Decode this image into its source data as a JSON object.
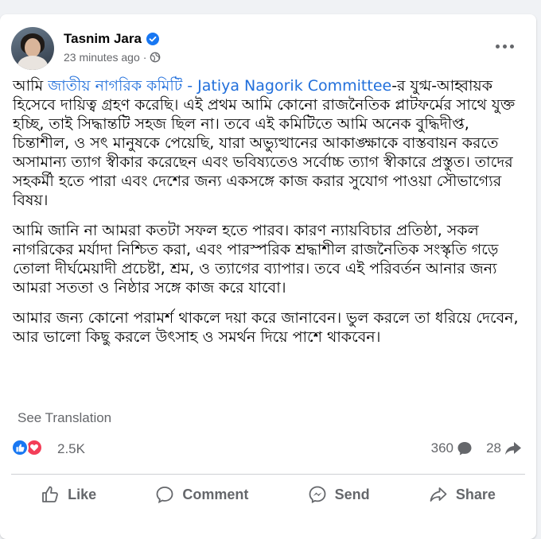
{
  "post": {
    "author": "Tasnim Jara",
    "timestamp": "23 minutes ago",
    "separator": "·",
    "paragraphs": {
      "p1_prefix": "আমি ",
      "p1_link1": "জাতীয় নাগরিক কমিটি - Jatiya Nagorik Committee",
      "p1_rest": "-র যুগ্ম-আহ্বায়ক হিসেবে দায়িত্ব গ্রহণ করেছি। এই প্রথম আমি কোনো রাজনৈতিক প্লাটফর্মের সাথে যুক্ত হচ্ছি, তাই সিদ্ধান্তটি সহজ ছিল না। তবে এই কমিটিতে আমি অনেক বুদ্ধিদীপ্ত, চিন্তাশীল, ও সৎ মানুষকে পেয়েছি, যারা অভ্যুত্থানের আকাঙ্ক্ষাকে বাস্তবায়ন করতে অসামান্য ত্যাগ স্বীকার করেছেন এবং ভবিষ্যতেও সর্বোচ্চ ত্যাগ স্বীকারে প্রস্তুত। তাদের সহকর্মী হতে পারা এবং দেশের জন্য একসঙ্গে কাজ করার সুযোগ পাওয়া সৌভাগ্যের বিষয়।",
      "p2": "আমি জানি না আমরা কতটা সফল হতে পারব। কারণ ন্যায়বিচার প্রতিষ্ঠা, সকল নাগরিকের মর্যাদা নিশ্চিত করা, এবং পারস্পরিক শ্রদ্ধাশীল রাজনৈতিক সংস্কৃতি গড়ে তোলা দীর্ঘমেয়াদী প্রচেষ্টা, শ্রম, ও ত্যাগের ব্যাপার। তবে এই পরিবর্তন আনার জন্য আমরা সততা ও নিষ্ঠার সঙ্গে কাজ করে যাবো।",
      "p3": "আমার জন্য কোনো পরামর্শ থাকলে দয়া করে জানাবেন। ভুল করলে তা ধরিয়ে দেবেন, আর ভালো কিছু করলে উৎসাহ ও সমর্থন দিয়ে পাশে থাকবেন।"
    },
    "see_translation": "See Translation"
  },
  "stats": {
    "reactions": "2.5K",
    "comments": "360",
    "shares": "28"
  },
  "actions": {
    "like": "Like",
    "comment": "Comment",
    "send": "Send",
    "share": "Share"
  },
  "colors": {
    "link": "#216fdb",
    "like_blue": "#1877f2",
    "love_red": "#f33e58",
    "secondary_text": "#65676b"
  },
  "icons": [
    "verified-badge-icon",
    "globe-icon",
    "more-options-icon",
    "like-reaction-icon",
    "love-reaction-icon",
    "comment-bubble-icon",
    "share-arrow-icon",
    "thumbs-up-icon",
    "comment-icon",
    "messenger-icon",
    "share-icon"
  ]
}
